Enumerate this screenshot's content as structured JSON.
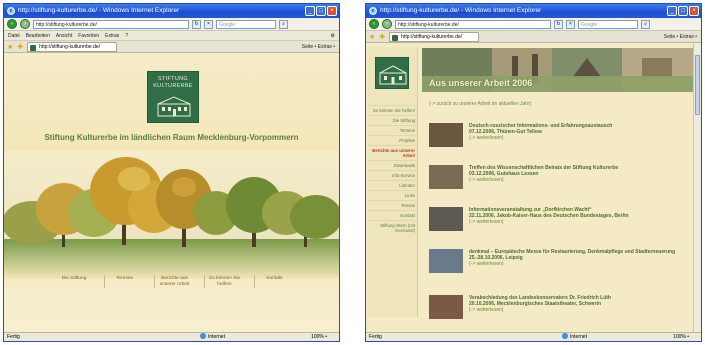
{
  "window1": {
    "title": "http://stiftung-kulturerbe.de/ - Windows Internet Explorer",
    "address": "http://stiftung-kulturerbe.de/",
    "search_placeholder": "Google",
    "menu": [
      "Datei",
      "Bearbeiten",
      "Ansicht",
      "Favoriten",
      "Extras",
      "?"
    ],
    "tab_label": "http://stiftung-kulturerbe.de/",
    "tools": "Seite • Extras •",
    "logo_text": "STIFTUNG KULTURERBE",
    "headline": "Stiftung Kulturerbe im ländlichen Raum Mecklenburg-Vorpommern",
    "nav": [
      "Die Stiftung",
      "Termine",
      "Berichte aus unserer Arbeit",
      "So können Sie helfen!",
      "Kontakt"
    ],
    "status_left": "Fertig",
    "status_net": "Internet",
    "status_zoom": "100% •"
  },
  "window2": {
    "title": "http://stiftung-kulturerbe.de/ - Windows Internet Explorer",
    "address": "http://stiftung-kulturerbe.de/",
    "search_placeholder": "Google",
    "tab_label": "http://stiftung-kulturerbe.de/",
    "tools": "Seite • Extras •",
    "banner_title": "Aus unserer Arbeit 2006",
    "back_link": "(-> zurück zu unserer Arbeit im aktuellen Jahr)",
    "sidebar": [
      "So können Sie helfen!",
      "Die Stiftung",
      "Termine",
      "Projekte",
      "Berichte aus unserer Arbeit",
      "Downloads",
      "Info-Service",
      "Literatur",
      "Links",
      "Presse",
      "Kontakt",
      "Stiftung intern (mit Kennwort)"
    ],
    "news": [
      {
        "title": "Deutsch-russischer Informations- und Erfahrungsaustausch",
        "meta": "07.12.2006, Thünen-Gut Tellow",
        "more": "(-> weiterlesen)"
      },
      {
        "title": "Treffen des Wissenschaftlichen Beirats der Stiftung Kulturerbe",
        "meta": "03.12.2006, Gutshaus Lexsen",
        "more": "(-> weiterlesen)"
      },
      {
        "title": "Informationsveranstaltung zur „Dorfkirchen Wacht“",
        "meta": "22.11.2006, Jakob-Kaiser-Haus des Deutschen Bundestages, Berlin",
        "more": "(-> weiterlesen)"
      },
      {
        "title": "denkmal – Europäische Messe für Restaurierung, Denkmalpflege und Stadterneuerung",
        "meta": "25.-28.10.2006, Leipzig",
        "more": "(-> weiterlesen)"
      },
      {
        "title": "Verabschiedung des Landeskonservators Dr. Friedrich Lüth",
        "meta": "20.10.2006, Mecklenburgisches Staatstheater, Schwerin",
        "more": "(-> weiterlesen)"
      }
    ],
    "status_left": "Fertig",
    "status_net": "Internet",
    "status_zoom": "100% •"
  },
  "colors": {
    "accent_green": "#2f6e46",
    "text_green": "#5a7f3c",
    "link_brown": "#8a5a2a",
    "page_bg": "#f4ebc6"
  }
}
